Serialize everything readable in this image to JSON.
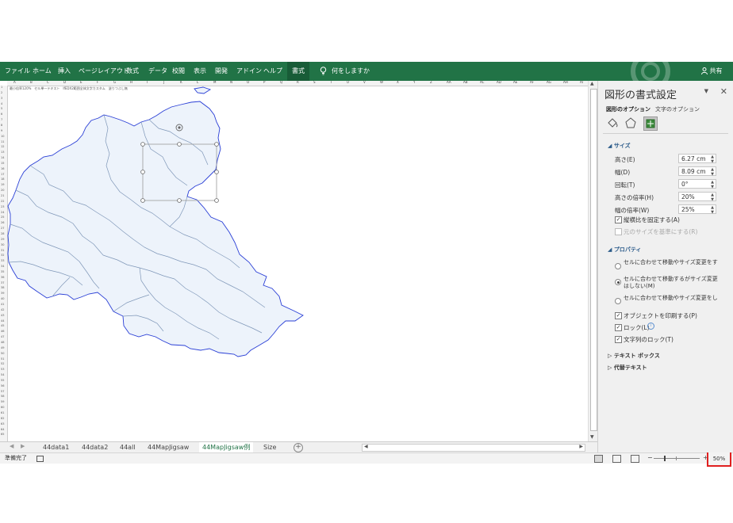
{
  "ribbon": {
    "tabs": [
      "ファイル",
      "ホーム",
      "挿入",
      "ページレイアウト",
      "数式",
      "データ",
      "校閲",
      "表示",
      "開発",
      "アドイン",
      "ヘルプ"
    ],
    "active_tab": "書式",
    "search": "何をしますか",
    "share": "共有"
  },
  "sheet": {
    "columns": [
      "A",
      "B",
      "C",
      "D",
      "E",
      "F",
      "G",
      "H",
      "I",
      "J",
      "K",
      "L",
      "M",
      "N",
      "O",
      "P",
      "Q",
      "R",
      "S",
      "T",
      "U",
      "V",
      "W",
      "X",
      "Y",
      "Z",
      "AA",
      "AB",
      "AC",
      "AD",
      "AE",
      "AF",
      "AG",
      "AH",
      "AI"
    ],
    "cell_note": "最小倍率120%　セル単一テキスト　IfEDX2範囲全体文字カスタム　塗りつぶし無"
  },
  "sheet_tabs": [
    "44data1",
    "44data2",
    "44all",
    "44MapJigsaw",
    "44MapJigsaw例",
    "Size"
  ],
  "active_sheet": "44MapJigsaw例",
  "status": {
    "text": "準備完了",
    "zoom": "50%"
  },
  "pane": {
    "title": "図形の書式設定",
    "tabs": [
      "図形のオプション",
      "文字のオプション"
    ],
    "size_section": "サイズ",
    "fields": [
      {
        "label": "高さ(E)",
        "value": "6.27 cm"
      },
      {
        "label": "幅(D)",
        "value": "8.09 cm"
      },
      {
        "label": "回転(T)",
        "value": "0°"
      },
      {
        "label": "高さの倍率(H)",
        "value": "20%"
      },
      {
        "label": "幅の倍率(W)",
        "value": "25%"
      }
    ],
    "lock_aspect": "縦横比を固定する(A)",
    "relative_original": "元のサイズを基準にする(R)",
    "props_section": "プロパティ",
    "radio1": "セルに合わせて移動やサイズ変更をする(S)",
    "radio2": "セルに合わせて移動するがサイズ変更はしない(M)",
    "radio3": "セルに合わせて移動やサイズ変更をしない(D)",
    "print_obj": "オブジェクトを印刷する(P)",
    "lock": "ロック(L)",
    "lock_text": "文字列のロック(T)",
    "textbox": "テキスト ボックス",
    "alt_text": "代替テキスト"
  },
  "colors": {
    "excel_green": "#217346",
    "map_fill": "#edf3fb",
    "map_stroke": "#2a3fd6",
    "zoom_highlight": "#e02020"
  }
}
